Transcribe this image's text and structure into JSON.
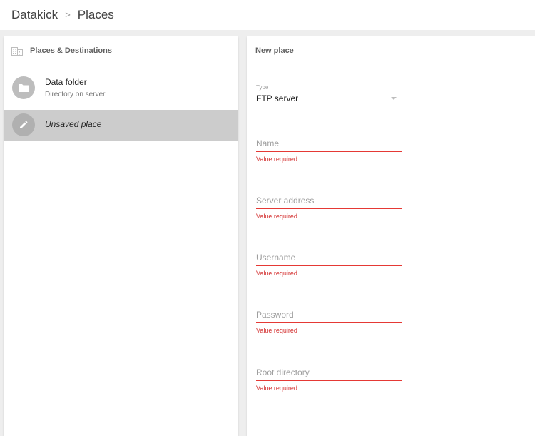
{
  "breadcrumb": {
    "root": "Datakick",
    "separator": ">",
    "current": "Places"
  },
  "left_panel": {
    "title": "Places & Destinations",
    "title_icon": "building-icon",
    "items": [
      {
        "title": "Data folder",
        "subtitle": "Directory on server",
        "icon": "folder-icon",
        "selected": false
      },
      {
        "title": "Unsaved place",
        "subtitle": "",
        "icon": "pencil-icon",
        "selected": true
      }
    ]
  },
  "form": {
    "title": "New place",
    "type": {
      "label": "Type",
      "value": "FTP server"
    },
    "fields": [
      {
        "placeholder": "Name",
        "error": "Value required"
      },
      {
        "placeholder": "Server address",
        "error": "Value required"
      },
      {
        "placeholder": "Username",
        "error": "Value required"
      },
      {
        "placeholder": "Password",
        "error": "Value required"
      },
      {
        "placeholder": "Root directory",
        "error": "Value required"
      }
    ]
  },
  "colors": {
    "error": "#d32f2f",
    "selected_bg": "#cccccc"
  }
}
